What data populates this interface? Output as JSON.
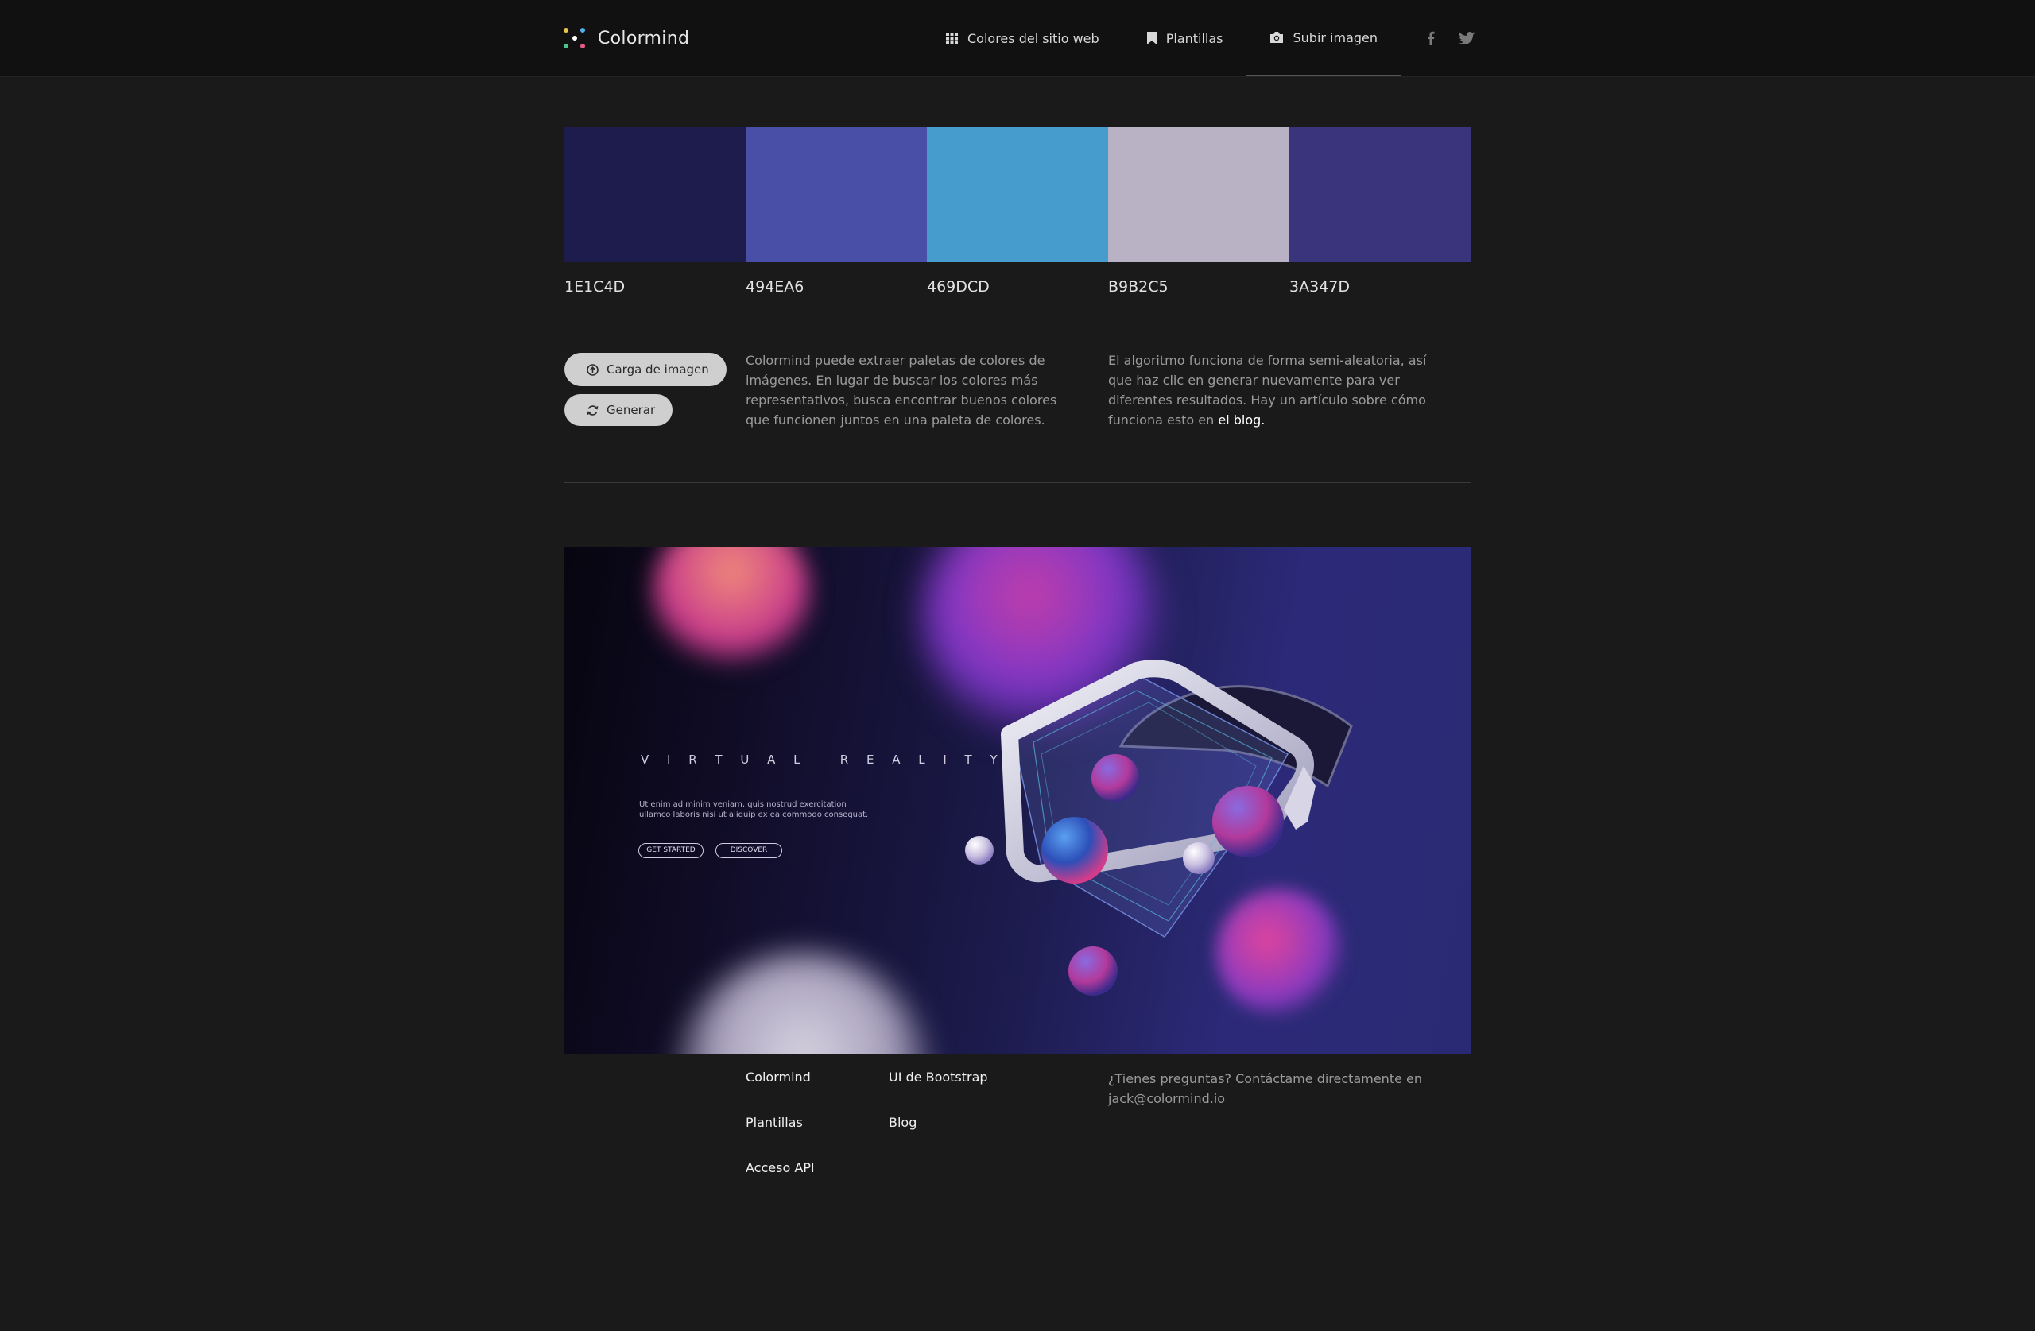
{
  "header": {
    "brand": "Colormind",
    "nav": [
      {
        "label": "Colores del sitio web",
        "icon": "grid-icon"
      },
      {
        "label": "Plantillas",
        "icon": "bookmark-icon"
      },
      {
        "label": "Subir imagen",
        "icon": "camera-icon",
        "active": true
      }
    ],
    "social": [
      "facebook-icon",
      "twitter-icon"
    ]
  },
  "palette": [
    {
      "hex": "1E1C4D",
      "color": "#1E1C4D"
    },
    {
      "hex": "494EA6",
      "color": "#494EA6"
    },
    {
      "hex": "469DCD",
      "color": "#469DCD"
    },
    {
      "hex": "B9B2C5",
      "color": "#B9B2C5"
    },
    {
      "hex": "3A347D",
      "color": "#3A347D"
    }
  ],
  "controls": {
    "upload_label": "Carga de imagen",
    "generate_label": "Generar"
  },
  "description": {
    "left": "Colormind puede extraer paletas de colores de imágenes. En lugar de buscar los colores más representativos, busca encontrar buenos colores que funcionen juntos en una paleta de colores.",
    "right_text": "El algoritmo funciona de forma semi-aleatoria, así que haz clic en generar nuevamente para ver diferentes resultados. Hay un artículo sobre cómo funciona esto en ",
    "right_link": "el blog."
  },
  "image": {
    "title": "V I R T U A L   R E A L I T Y",
    "body": "Ut enim ad minim veniam, quis nostrud exercitation ullamco laboris nisi ut aliquip ex ea commodo consequat.",
    "button_primary": "GET STARTED",
    "button_secondary": "DISCOVER"
  },
  "footer": {
    "links_col1": [
      "Colormind",
      "Plantillas",
      "Acceso API"
    ],
    "links_col2": [
      "UI de Bootstrap",
      "Blog"
    ],
    "contact": "¿Tienes preguntas? Contáctame directamente en jack@colormind.io"
  }
}
